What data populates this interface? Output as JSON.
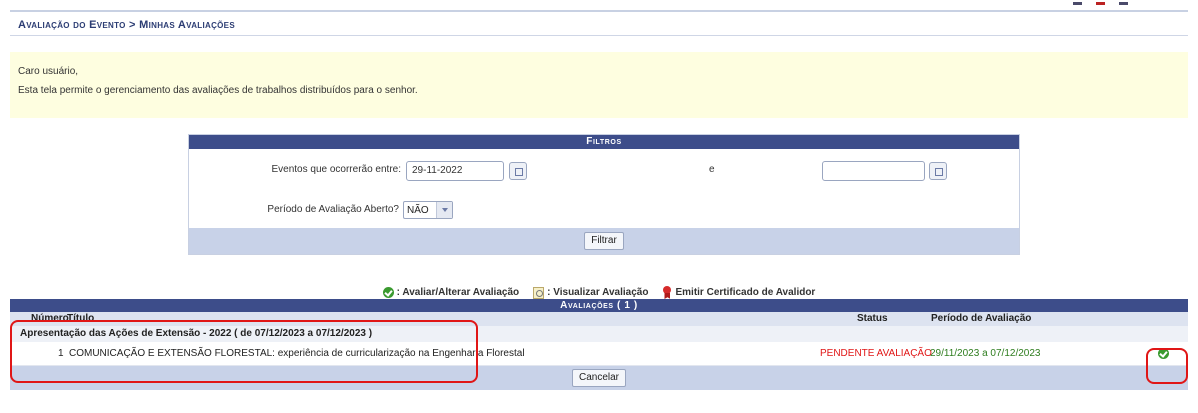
{
  "breadcrumb": "Avaliação do Evento > Minhas Avaliações",
  "notice": {
    "greeting": "Caro usuário,",
    "message": "Esta tela permite o gerenciamento das avaliações de trabalhos distribuídos para o senhor."
  },
  "filters": {
    "title": "Filtros",
    "events_label": "Eventos que ocorrerão entre:",
    "start_date": "29-11-2022",
    "connector": "e",
    "end_date": "",
    "open_period_label": "Período de Avaliação Aberto?",
    "open_period_value": "NÃO",
    "submit_label": "Filtrar"
  },
  "legend": {
    "evaluate": ": Avaliar/Alterar Avaliação",
    "view": ": Visualizar Avaliação",
    "certificate": "Emitir Certificado de Avalidor"
  },
  "evaluations": {
    "title": "Avaliações ( 1 )",
    "columns": {
      "number": "Número",
      "title": "Título",
      "status": "Status",
      "period": "Período de Avaliação"
    },
    "group": "Apresentação das Ações de Extensão - 2022 ( de 07/12/2023 a 07/12/2023 )",
    "rows": [
      {
        "number": "1",
        "title": "COMUNICAÇÃO E EXTENSÃO FLORESTAL: experiência de curricularização na Engenharia Florestal",
        "status": "PENDENTE AVALIAÇÃO",
        "period": "29/11/2023 a 07/12/2023"
      }
    ],
    "cancel_label": "Cancelar"
  },
  "colors": {
    "header_blue": "#3d4d8a",
    "status_pending": "#e01616",
    "period_green": "#2e7d1e",
    "highlight_red": "#e01616"
  }
}
